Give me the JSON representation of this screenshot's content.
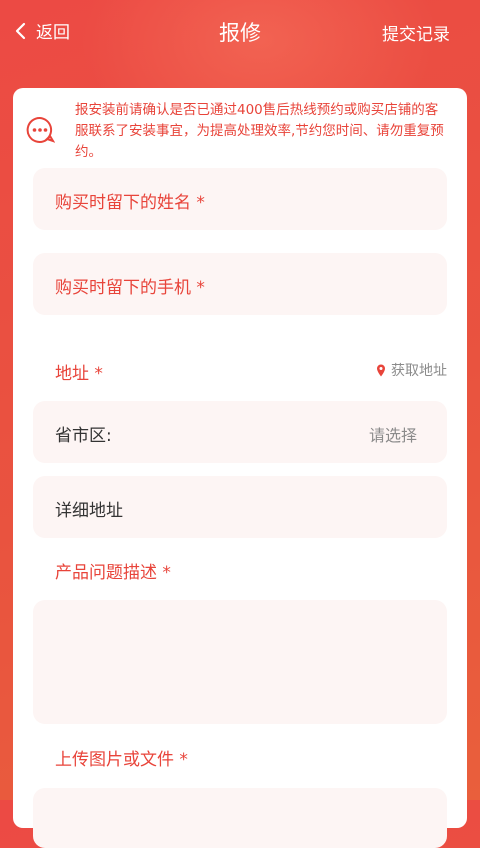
{
  "header": {
    "back_label": "返回",
    "title": "报修",
    "records_label": "提交记录"
  },
  "notice": {
    "text": "报安装前请确认是否已通过400售后热线预约或购买店铺的客服联系了安装事宜，为提高处理效率,节约您时间、请勿重复预约。",
    "icon": "chat-bubble-icon"
  },
  "form": {
    "name_label": "购买时留下的姓名 *",
    "phone_label": "购买时留下的手机 *",
    "address_label": "地址 *",
    "get_address_label": "获取地址",
    "region_label": "省市区:",
    "region_value": "请选择",
    "detail_address_label": "详细地址",
    "problem_label": "产品问题描述 *",
    "upload_label": "上传图片或文件 *"
  },
  "colors": {
    "accent": "#e8443a",
    "field_bg": "#fdf5f4",
    "header_bg": "#ec4a44"
  }
}
